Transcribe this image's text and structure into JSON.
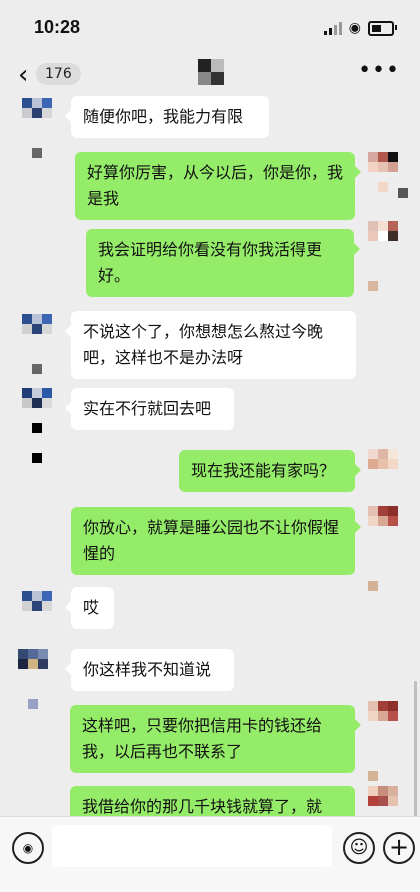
{
  "status_bar": {
    "time": "10:28"
  },
  "nav": {
    "back_count": "176"
  },
  "messages": [
    {
      "side": "left",
      "text": "随便你吧，我能力有限"
    },
    {
      "side": "right",
      "text": "好算你厉害，从今以后，你是你，我是我"
    },
    {
      "side": "right",
      "text": "我会证明给你看没有你我活得更好。"
    },
    {
      "side": "left",
      "text": "不说这个了，你想想怎么熬过今晚吧，这样也不是办法呀"
    },
    {
      "side": "left",
      "text": "实在不行就回去吧"
    },
    {
      "side": "right",
      "text": "现在我还能有家吗？"
    },
    {
      "side": "right",
      "text": "你放心，就算是睡公园也不让你假惺惺的"
    },
    {
      "side": "left",
      "text": "哎"
    },
    {
      "side": "left",
      "text": "你这样我不知道说"
    },
    {
      "side": "right",
      "text": "这样吧，只要你把信用卡的钱还给我，以后再也不联系了"
    },
    {
      "side": "right",
      "text": "我借给你的那几千块钱就算了，就"
    }
  ],
  "input": {
    "placeholder": ""
  },
  "colors": {
    "right_bubble": "#95ec69",
    "left_bubble": "#ffffff",
    "background": "#ededed"
  }
}
